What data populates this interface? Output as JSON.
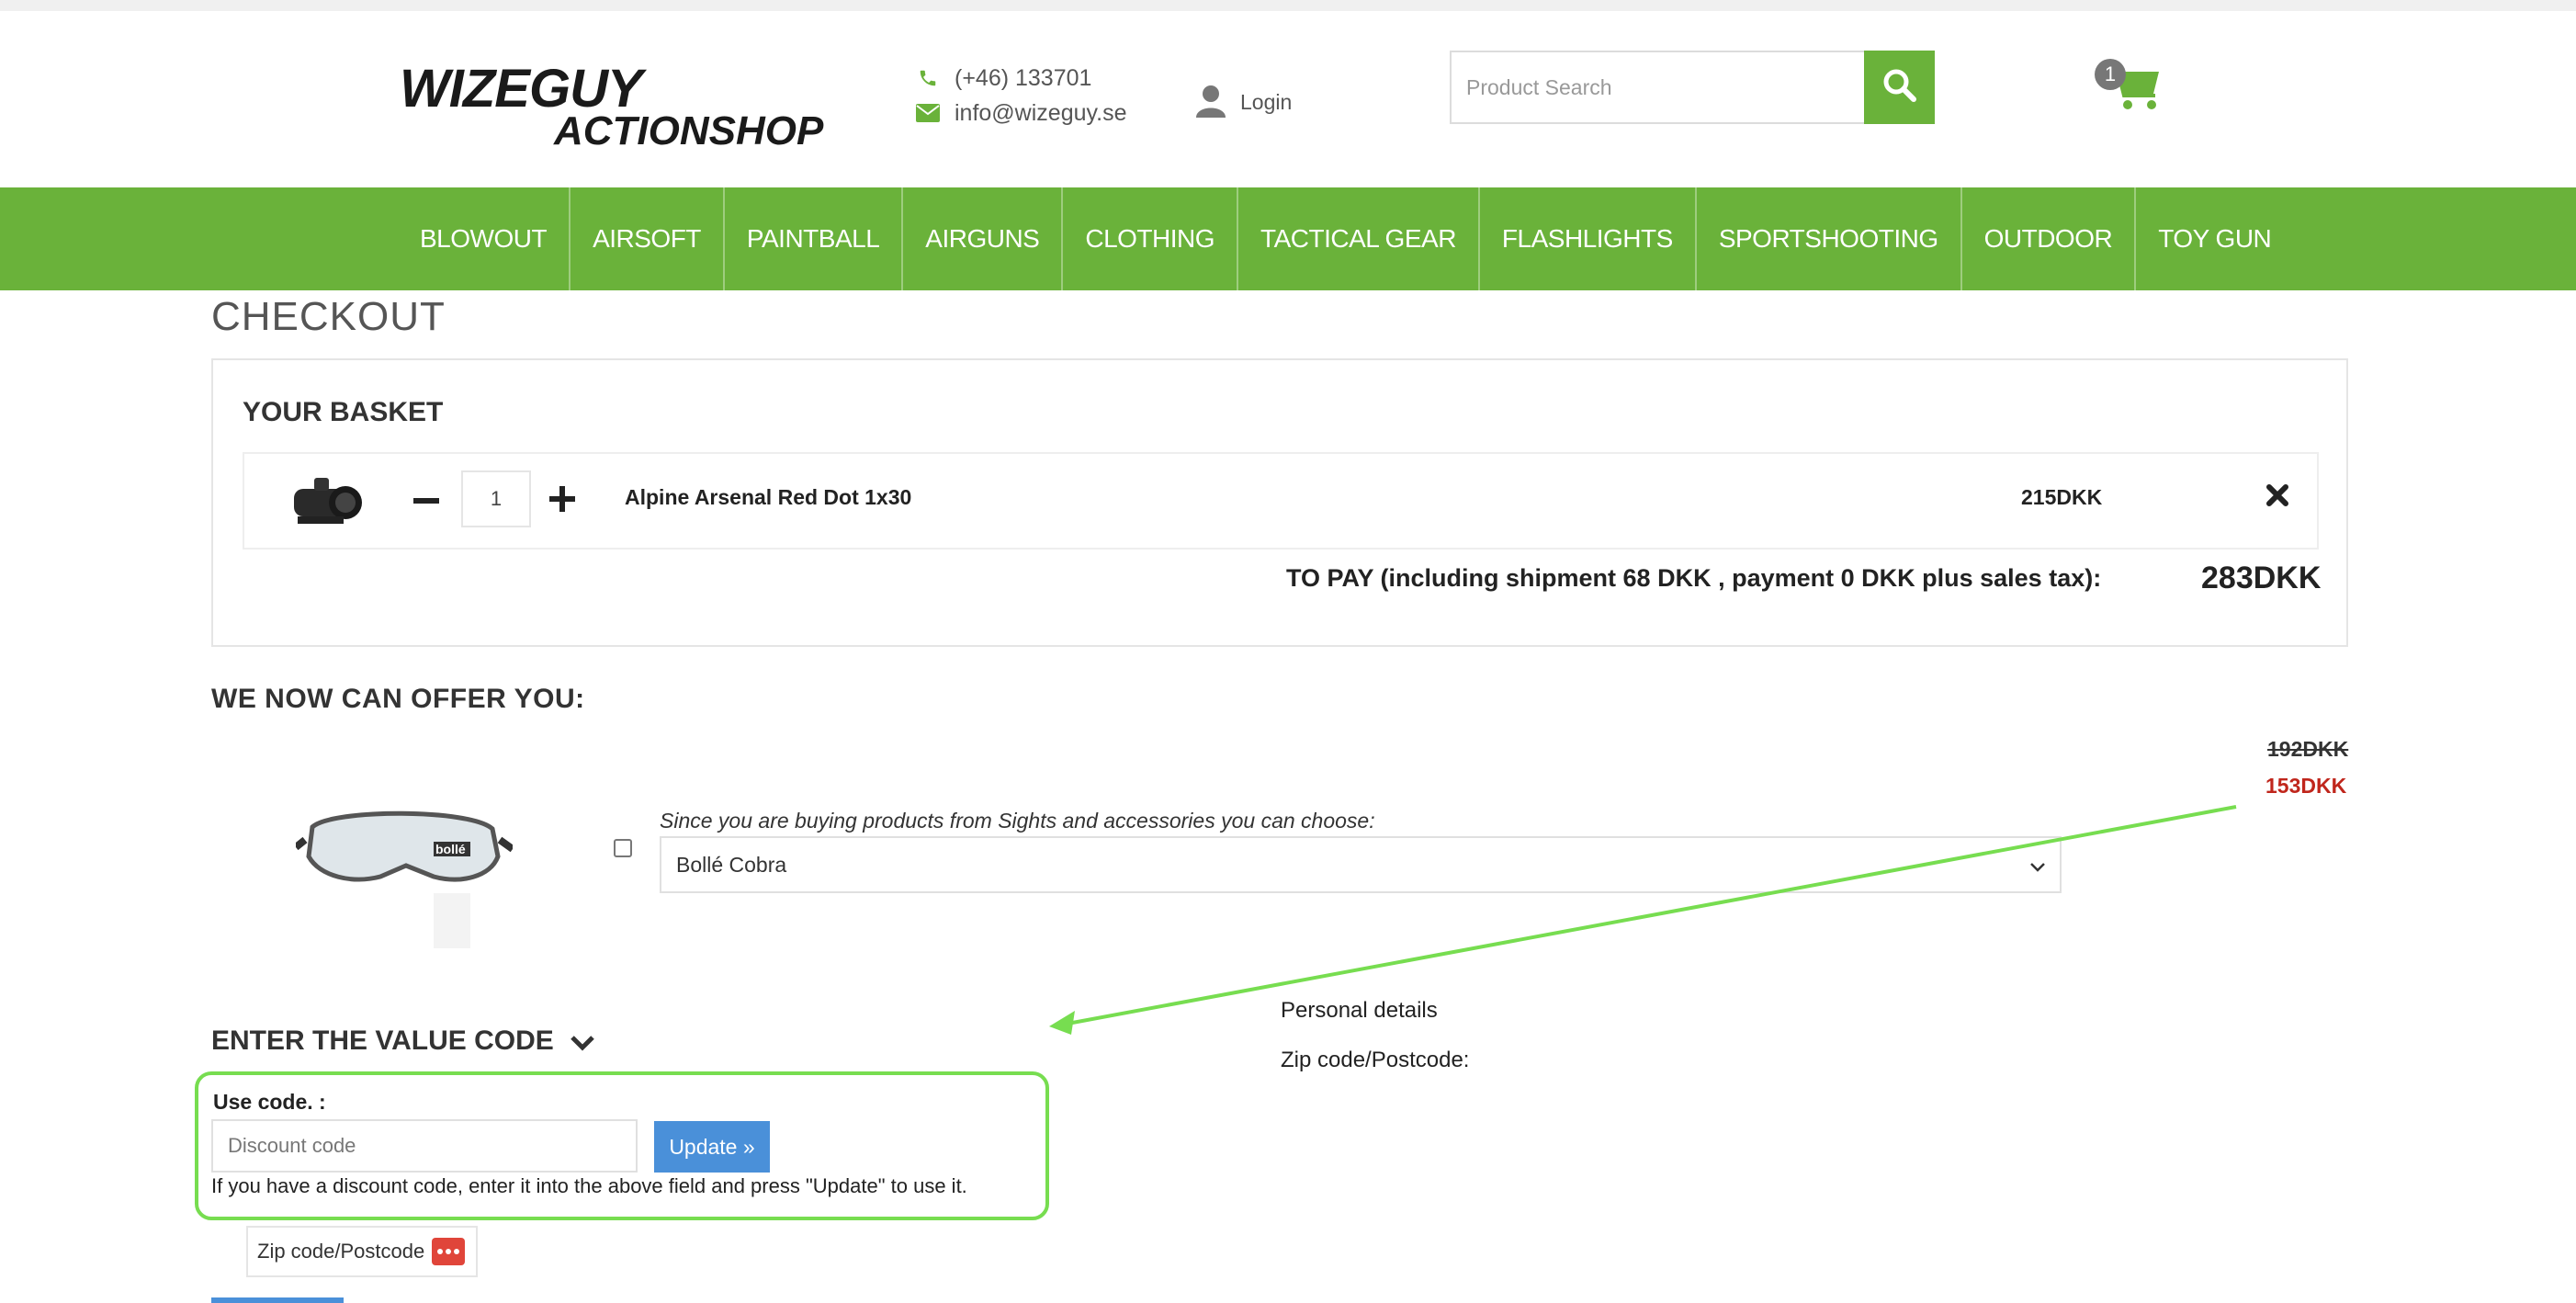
{
  "header": {
    "logo_line1": "WIZEGUY",
    "logo_line2": "ACTIONSHOP",
    "phone": "(+46) 133701",
    "email": "info@wizeguy.se",
    "login_label": "Login",
    "search_placeholder": "Product Search",
    "cart_count": "1"
  },
  "nav": {
    "items": [
      "BLOWOUT",
      "AIRSOFT",
      "PAINTBALL",
      "AIRGUNS",
      "CLOTHING",
      "TACTICAL GEAR",
      "FLASHLIGHTS",
      "SPORTSHOOTING",
      "OUTDOOR",
      "TOY GUN"
    ]
  },
  "checkout": {
    "title": "CHECKOUT",
    "basket_heading": "YOUR BASKET",
    "item": {
      "quantity": "1",
      "name": "Alpine Arsenal Red Dot 1x30",
      "price": "215DKK"
    },
    "to_pay_label": "TO PAY (including shipment 68 DKK , payment 0 DKK plus sales tax):",
    "total": "283DKK"
  },
  "offer": {
    "heading": "WE NOW CAN OFFER YOU:",
    "old_price": "192DKK",
    "new_price": "153DKK",
    "description": "Since you are buying products from Sights and accessories you can choose:",
    "selected_option": "Bollé Cobra",
    "goggle_brand_text": "bollé"
  },
  "value_code": {
    "heading": "ENTER THE VALUE CODE",
    "use_code_label": "Use code. :",
    "input_placeholder": "Discount code",
    "update_label": "Update »",
    "help_text": "If you have a discount code, enter it into the above field and press \"Update\" to use it."
  },
  "personal": {
    "heading": "Personal details",
    "zip_label": "Zip code/Postcode:",
    "zip_placeholder": "Zip code/Postcode"
  },
  "colors": {
    "brand_green": "#6ab23a",
    "annotation_green": "#77dd50",
    "sale_red": "#c0261c",
    "button_blue": "#4a90d9"
  },
  "icons": [
    "phone-icon",
    "envelope-icon",
    "user-icon",
    "search-icon",
    "cart-icon",
    "minus-icon",
    "plus-icon",
    "close-icon",
    "chevron-down-icon",
    "password-manager-icon"
  ]
}
